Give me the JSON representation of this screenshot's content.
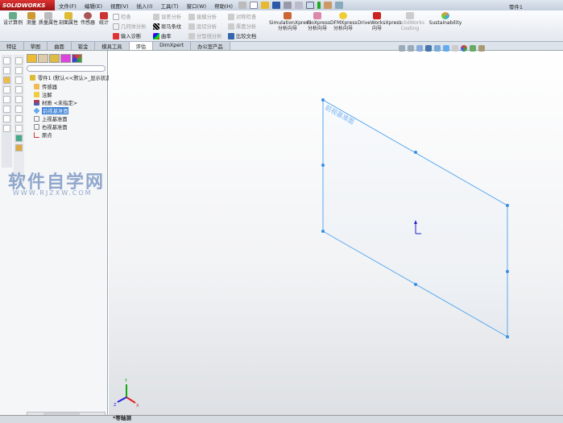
{
  "title_bar": {
    "logo": "SOLIDWORKS",
    "menus": [
      "文件(F)",
      "编辑(E)",
      "视图(V)",
      "插入(I)",
      "工具(T)",
      "窗口(W)",
      "帮助(H)"
    ],
    "document_title": "零件1"
  },
  "ribbon": {
    "large": [
      {
        "label": "设计算例"
      },
      {
        "label": "测量"
      },
      {
        "label": "质量属性"
      },
      {
        "label": "剖面属性"
      },
      {
        "label": "传感器"
      },
      {
        "label": "统计"
      }
    ],
    "small_col1": [
      "检查",
      "几何体分析",
      "输入诊断"
    ],
    "small_col2": [
      "误差分析",
      "斑马条纹",
      "曲率"
    ],
    "small_col3": [
      "拔模分析",
      "底切分析",
      "分型线分析"
    ],
    "small_col4": [
      "对称检查",
      "厚度分析",
      "比较文档"
    ],
    "xpress": [
      {
        "label": "SimulationXpress 分析向导"
      },
      {
        "label": "FloXpress 分析向导"
      },
      {
        "label": "DFMXpress 分析向导"
      },
      {
        "label": "DriveWorksXpress 向导"
      },
      {
        "label": "SolidWorks Costing"
      },
      {
        "label": "Sustainability"
      }
    ]
  },
  "tabs": [
    "特征",
    "草图",
    "曲面",
    "钣金",
    "模具工具",
    "评估",
    "DimXpert",
    "办公室产品"
  ],
  "active_tab": "评估",
  "feature_tree": {
    "root": "零件1 (默认<<默认>_显示状态",
    "items": [
      "传感器",
      "注解",
      "材质 <未指定>",
      "前视基准面",
      "上视基准面",
      "右视基准面",
      "原点"
    ],
    "selected": "前视基准面"
  },
  "watermark": {
    "text": "软件自学网",
    "url": "WWW.RJZXW.COM"
  },
  "viewport": {
    "plane_label": "前视基准面",
    "view_orientation": "*等轴测",
    "triad": {
      "x": "X",
      "y": "Y",
      "z": "Z"
    }
  },
  "colors": {
    "plane": "#5aa8f0",
    "selection": "#3a7fd5",
    "brand": "#c22"
  }
}
